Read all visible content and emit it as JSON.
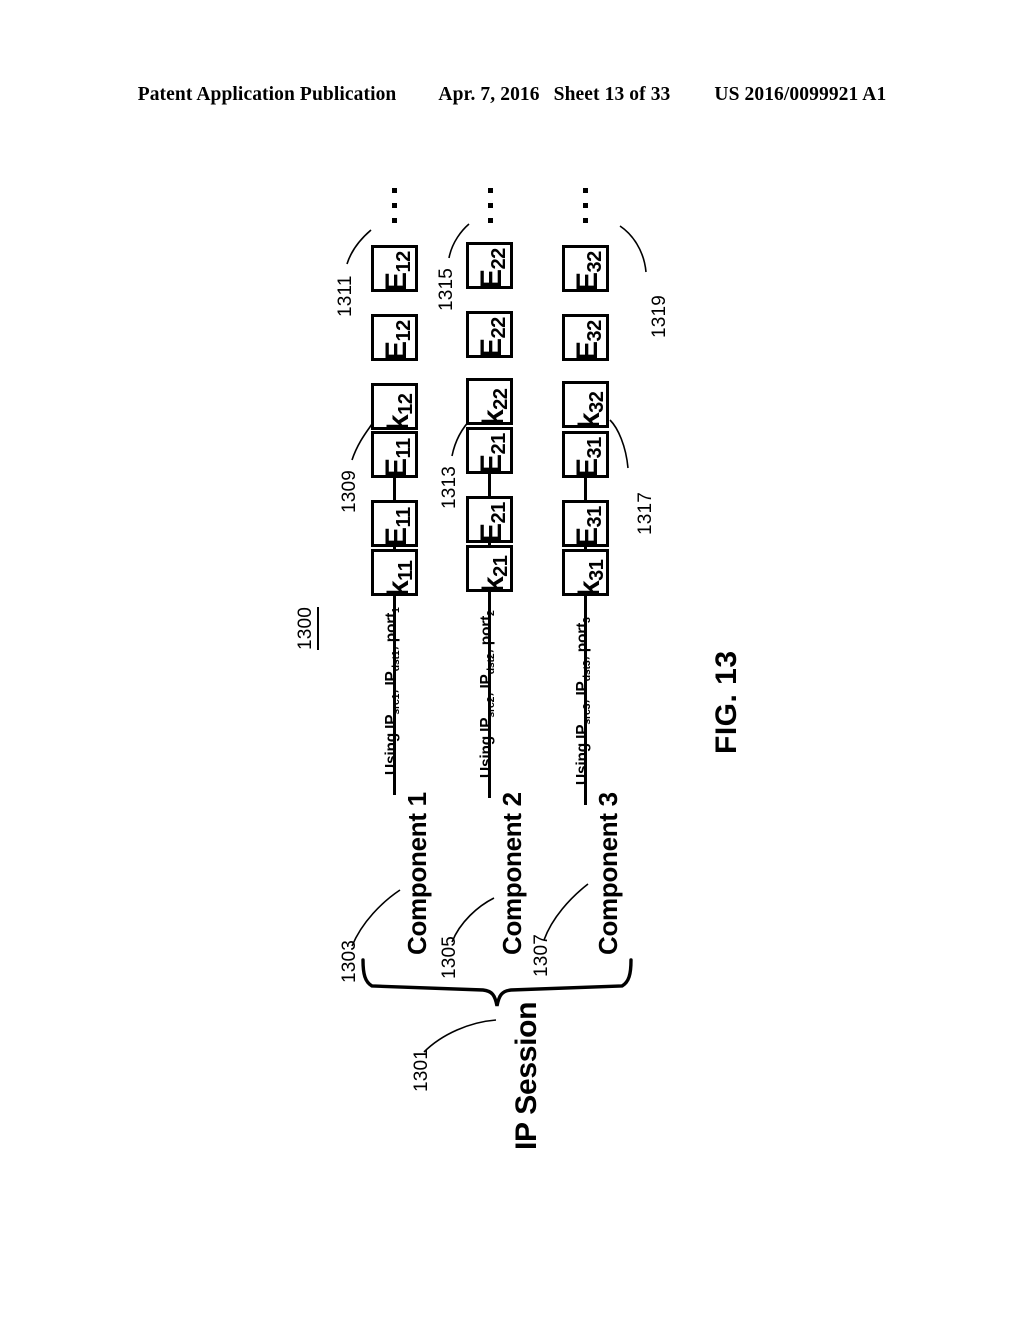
{
  "header": {
    "publication": "Patent Application Publication",
    "date": "Apr. 7, 2016",
    "sheet": "Sheet 13 of 33",
    "number": "US 2016/0099921 A1"
  },
  "figure": {
    "label": "FIG. 13",
    "diagram_ref": "1300",
    "session_label": "IP Session",
    "session_ref": "1301",
    "components": [
      {
        "label": "Component 1",
        "ref": "1303",
        "flow_prefix": "Using IP",
        "flow_src_sub": "src1",
        "flow_sep1": ", IP",
        "flow_dst_sub": "dst1",
        "flow_sep2": ", port",
        "flow_port_sub": "1",
        "key_ref": "1309",
        "key2_ref": "1311",
        "boxes": [
          "k",
          "E",
          "E",
          "k",
          "E",
          "E"
        ],
        "box_subs": [
          "11",
          "11",
          "11",
          "12",
          "12",
          "12"
        ]
      },
      {
        "label": "Component 2",
        "ref": "1305",
        "flow_prefix": "Using IP",
        "flow_src_sub": "src2",
        "flow_sep1": ", IP",
        "flow_dst_sub": "dst2",
        "flow_sep2": ", port",
        "flow_port_sub": "2",
        "key_ref": "1313",
        "key2_ref": "1315",
        "boxes": [
          "k",
          "E",
          "E",
          "k",
          "E",
          "E"
        ],
        "box_subs": [
          "21",
          "21",
          "21",
          "22",
          "22",
          "22"
        ]
      },
      {
        "label": "Component 3",
        "ref": "1307",
        "flow_prefix": "Using IP",
        "flow_src_sub": "src3",
        "flow_sep1": ", IP",
        "flow_dst_sub": "dst3",
        "flow_sep2": ", port",
        "flow_port_sub": "3",
        "key_ref": "1317",
        "key2_ref": "1319",
        "boxes": [
          "k",
          "E",
          "E",
          "k",
          "E",
          "E"
        ],
        "box_subs": [
          "31",
          "31",
          "31",
          "32",
          "32",
          "32"
        ]
      }
    ],
    "ellipsis": "· · ·"
  },
  "colors": {
    "ink": "#000000",
    "paper": "#ffffff"
  }
}
